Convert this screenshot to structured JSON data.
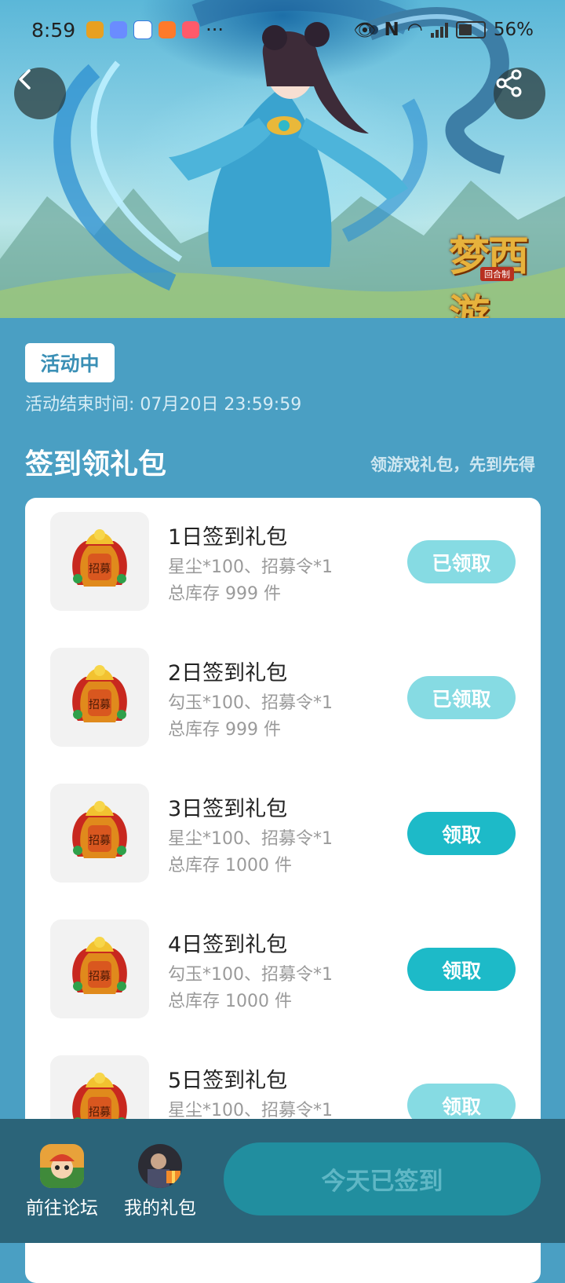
{
  "status_bar": {
    "time": "8:59",
    "more": "···",
    "battery": "56%"
  },
  "header": {
    "game_logo_text": "梦西游",
    "game_logo_sub": "回合制"
  },
  "event": {
    "status": "活动中",
    "end_time": "活动结束时间: 07月20日 23:59:59"
  },
  "section": {
    "title": "签到领礼包",
    "subtitle": "领游戏礼包，先到先得"
  },
  "gifts": [
    {
      "title": "1日签到礼包",
      "desc": "星尘*100、招募令*1",
      "stock": "总库存 999 件",
      "button": "已领取",
      "state": "claimed"
    },
    {
      "title": "2日签到礼包",
      "desc": "勾玉*100、招募令*1",
      "stock": "总库存 999 件",
      "button": "已领取",
      "state": "claimed"
    },
    {
      "title": "3日签到礼包",
      "desc": "星尘*100、招募令*1",
      "stock": "总库存 1000 件",
      "button": "领取",
      "state": "available"
    },
    {
      "title": "4日签到礼包",
      "desc": "勾玉*100、招募令*1",
      "stock": "总库存 1000 件",
      "button": "领取",
      "state": "available"
    },
    {
      "title": "5日签到礼包",
      "desc": "星尘*100、招募令*1",
      "stock": "",
      "button": "领取",
      "state": "locked"
    }
  ],
  "gift_icon_text": "招募",
  "bottom": {
    "forum_label": "前往论坛",
    "my_gifts_label": "我的礼包",
    "signin_button": "今天已签到"
  },
  "colors": {
    "page_bg": "#4a9fc3",
    "claim_active": "#1dbac8",
    "claim_done": "#86dbe3",
    "bottom_bar": "#2b6479"
  }
}
